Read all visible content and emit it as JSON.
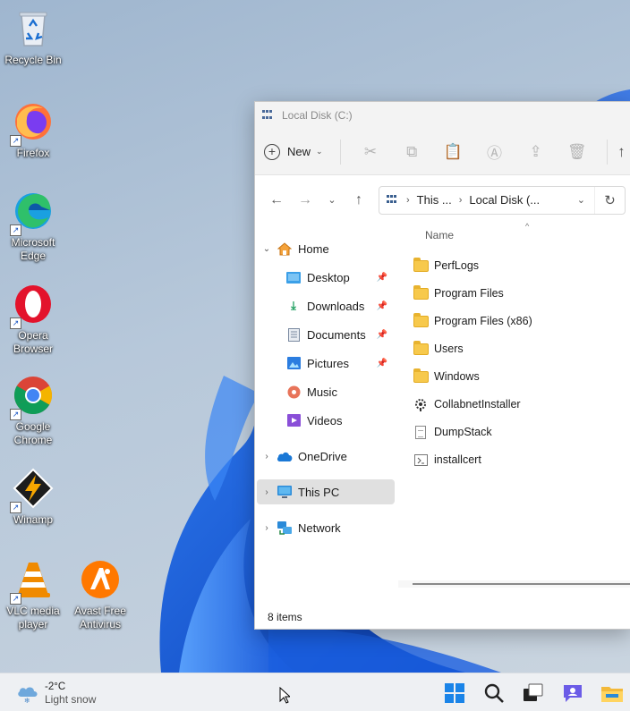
{
  "desktop": {
    "icons": [
      {
        "label": "Recycle Bin"
      },
      {
        "label": "Firefox"
      },
      {
        "label": "Microsoft Edge"
      },
      {
        "label": "Opera Browser"
      },
      {
        "label": "Google Chrome"
      },
      {
        "label": "Winamp"
      },
      {
        "label": "VLC media player"
      },
      {
        "label": "Avast Free Antivirus"
      }
    ]
  },
  "explorer": {
    "title": "Local Disk (C:)",
    "commandbar": {
      "new_label": "New",
      "actions": [
        "cut-icon",
        "copy-icon",
        "paste-icon",
        "rename-icon",
        "share-icon",
        "delete-icon"
      ]
    },
    "address": {
      "crumb1": "This ...",
      "crumb2": "Local Disk (..."
    },
    "nav": {
      "home": "Home",
      "desktop": "Desktop",
      "downloads": "Downloads",
      "documents": "Documents",
      "pictures": "Pictures",
      "music": "Music",
      "videos": "Videos",
      "onedrive": "OneDrive",
      "thispc": "This PC",
      "network": "Network"
    },
    "files": {
      "column_name": "Name",
      "items": [
        {
          "name": "PerfLogs",
          "type": "folder"
        },
        {
          "name": "Program Files",
          "type": "folder"
        },
        {
          "name": "Program Files (x86)",
          "type": "folder"
        },
        {
          "name": "Users",
          "type": "folder"
        },
        {
          "name": "Windows",
          "type": "folder"
        },
        {
          "name": "CollabnetInstaller",
          "type": "app"
        },
        {
          "name": "DumpStack",
          "type": "file"
        },
        {
          "name": "installcert",
          "type": "script"
        }
      ]
    },
    "status": "8 items"
  },
  "taskbar": {
    "weather_temp": "-2°C",
    "weather_condition": "Light snow",
    "pinned": [
      "start-icon",
      "search-icon",
      "task-view-icon",
      "chat-icon",
      "file-explorer-icon"
    ]
  },
  "colors": {
    "accent": "#0067c0",
    "selection": "#e0e0e0",
    "folder": "#f7c94c"
  }
}
